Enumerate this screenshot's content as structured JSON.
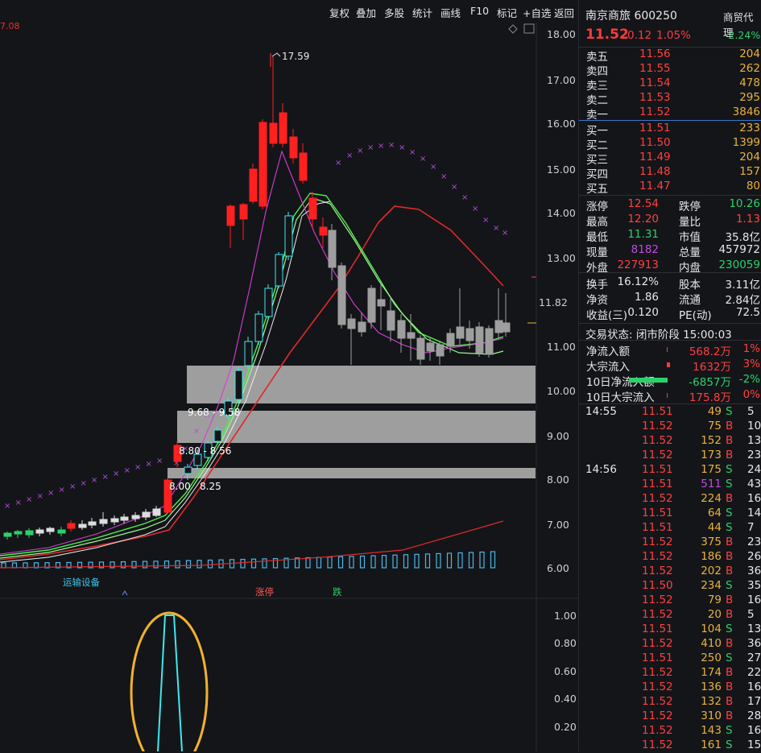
{
  "toolbar": {
    "items": [
      "复权",
      "叠加",
      "多股",
      "统计",
      "画线",
      "F10",
      "标记",
      "+自选",
      "返回"
    ]
  },
  "chart": {
    "top_left_price": "7.08",
    "y_axis": [
      "18.00",
      "17.00",
      "16.00",
      "15.00",
      "14.00",
      "13.00",
      "11.82",
      "11.00",
      "10.00",
      "9.00",
      "8.00",
      "7.00",
      "6.00"
    ],
    "current_price_label": "11.82",
    "high_label": "17.59",
    "annotations": [
      "9.68 - 9.58",
      "8.80 - 8.56",
      "8.00",
      "8.25"
    ],
    "bottom_labels": {
      "sector": "运输设备",
      "limit_up": "涨停",
      "fall": "跌"
    },
    "sub_y_axis": [
      "1.00",
      "0.80",
      "0.60",
      "0.40",
      "0.20"
    ]
  },
  "quote": {
    "name": "南京商旅",
    "code": "600250",
    "tag": "商贸代理",
    "price": "11.52",
    "change": "0.12",
    "change_pct": "1.05%",
    "tag_change": "-2.24%",
    "asks": [
      {
        "label": "卖五",
        "price": "11.56",
        "vol": "204"
      },
      {
        "label": "卖四",
        "price": "11.55",
        "vol": "262"
      },
      {
        "label": "卖三",
        "price": "11.54",
        "vol": "478"
      },
      {
        "label": "卖二",
        "price": "11.53",
        "vol": "295"
      },
      {
        "label": "卖一",
        "price": "11.52",
        "vol": "3846"
      }
    ],
    "bids": [
      {
        "label": "买一",
        "price": "11.51",
        "vol": "233"
      },
      {
        "label": "买二",
        "price": "11.50",
        "vol": "1399"
      },
      {
        "label": "买三",
        "price": "11.49",
        "vol": "204"
      },
      {
        "label": "买四",
        "price": "11.48",
        "vol": "157"
      },
      {
        "label": "买五",
        "price": "11.47",
        "vol": "80"
      }
    ],
    "stats1": [
      {
        "l1": "涨停",
        "v1": "12.54",
        "l2": "跌停",
        "v2": "10.26"
      },
      {
        "l1": "最高",
        "v1": "12.20",
        "l2": "量比",
        "v2": "1.13"
      },
      {
        "l1": "最低",
        "v1": "11.31",
        "l2": "市值",
        "v2": "35.8亿"
      },
      {
        "l1": "现量",
        "v1": "8182",
        "l2": "总量",
        "v2": "457972"
      },
      {
        "l1": "外盘",
        "v1": "227913",
        "l2": "内盘",
        "v2": "230059"
      }
    ],
    "stats2": [
      {
        "l1": "换手",
        "v1": "16.12%",
        "l2": "股本",
        "v2": "3.11亿"
      },
      {
        "l1": "净资",
        "v1": "1.86",
        "l2": "流通",
        "v2": "2.84亿"
      },
      {
        "l1": "收益(三)",
        "v1": "0.120",
        "l2": "PE(动)",
        "v2": "72.5"
      }
    ],
    "status": "交易状态: 闭市阶段 15:00:03",
    "flows": [
      {
        "label": "净流入额",
        "value": "568.2万",
        "pct": "1%"
      },
      {
        "label": "大宗流入",
        "value": "1632万",
        "pct": "3%"
      },
      {
        "label": "10日净流入额",
        "value": "-6857万",
        "pct": "-2%"
      },
      {
        "label": "10日大宗流入",
        "value": "175.8万",
        "pct": "0%"
      }
    ],
    "ticks_1455": [
      {
        "price": "11.51",
        "vol": "49",
        "side": "S",
        "n": "5"
      },
      {
        "price": "11.52",
        "vol": "75",
        "side": "B",
        "n": "10"
      },
      {
        "price": "11.52",
        "vol": "152",
        "side": "B",
        "n": "13"
      },
      {
        "price": "11.52",
        "vol": "173",
        "side": "B",
        "n": "23"
      }
    ],
    "ticks_1456": [
      {
        "price": "11.51",
        "vol": "175",
        "side": "S",
        "n": "24"
      },
      {
        "price": "11.51",
        "vol": "511",
        "side": "S",
        "n": "43"
      },
      {
        "price": "11.52",
        "vol": "224",
        "side": "B",
        "n": "16"
      },
      {
        "price": "11.51",
        "vol": "64",
        "side": "S",
        "n": "14"
      },
      {
        "price": "11.51",
        "vol": "44",
        "side": "S",
        "n": "7"
      },
      {
        "price": "11.52",
        "vol": "375",
        "side": "B",
        "n": "23"
      },
      {
        "price": "11.52",
        "vol": "186",
        "side": "B",
        "n": "26"
      },
      {
        "price": "11.52",
        "vol": "202",
        "side": "B",
        "n": "36"
      },
      {
        "price": "11.50",
        "vol": "234",
        "side": "S",
        "n": "35"
      },
      {
        "price": "11.52",
        "vol": "79",
        "side": "B",
        "n": "16"
      },
      {
        "price": "11.52",
        "vol": "20",
        "side": "B",
        "n": "5"
      },
      {
        "price": "11.51",
        "vol": "104",
        "side": "S",
        "n": "13"
      },
      {
        "price": "11.52",
        "vol": "410",
        "side": "B",
        "n": "36"
      },
      {
        "price": "11.51",
        "vol": "250",
        "side": "S",
        "n": "27"
      },
      {
        "price": "11.52",
        "vol": "174",
        "side": "B",
        "n": "22"
      },
      {
        "price": "11.52",
        "vol": "136",
        "side": "B",
        "n": "16"
      },
      {
        "price": "11.52",
        "vol": "132",
        "side": "B",
        "n": "17"
      },
      {
        "price": "11.52",
        "vol": "310",
        "side": "B",
        "n": "28"
      },
      {
        "price": "11.52",
        "vol": "143",
        "side": "S",
        "n": "16"
      },
      {
        "price": "11.52",
        "vol": "161",
        "side": "S",
        "n": "15"
      }
    ],
    "times": [
      "14:55",
      "14:56"
    ]
  },
  "colors": {
    "up": "#ff3b3b",
    "down": "#2bd26b",
    "bg": "#141519",
    "accent": "#e8b23c"
  }
}
